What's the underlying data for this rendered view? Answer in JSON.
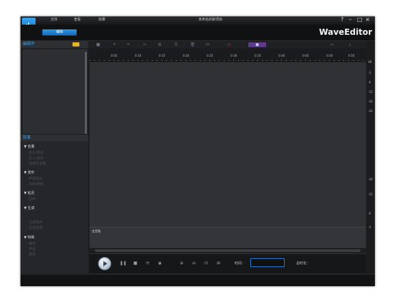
{
  "app": {
    "brand": "WaveEditor",
    "window_title": "未命名的新项目"
  },
  "menu": [
    {
      "label": "文件"
    },
    {
      "label": "查看"
    },
    {
      "label": "效果"
    }
  ],
  "window_controls": {
    "help": "?",
    "min": "–",
    "max": "□",
    "close": "×"
  },
  "ribbon": {
    "edit_tab": "编辑"
  },
  "left_panel": {
    "files_header": "编辑件",
    "effects_header": "效果",
    "categories": [
      {
        "label": "▼ 音量",
        "items": [
          "放大/衰减",
          "淡入/淡出",
          "标准化音量"
        ]
      },
      {
        "label": "▼ 变形",
        "items": [
          "声道混合",
          "反向/倒转"
        ]
      },
      {
        "label": "▼ 延迟",
        "items": [
          "回声"
        ]
      },
      {
        "label": "▼ 生成",
        "items": [
          "生成噪声",
          "生成音调"
        ]
      },
      {
        "label": "▼ 特殊",
        "items": [
          "静音",
          "声道",
          "重复"
        ]
      }
    ]
  },
  "timeline": {
    "ticks": [
      "0:05",
      "0:10",
      "0:15",
      "0:20",
      "0:25",
      "0:30",
      "0:35",
      "0:40",
      "0:45",
      "0:50",
      "0:55"
    ]
  },
  "meter": {
    "labels": [
      "dB",
      "-3",
      "-6",
      "-12",
      "-18",
      "-24",
      "-18",
      "-12",
      "-6",
      "-3"
    ]
  },
  "master": {
    "label": "主音轨"
  },
  "transport": {
    "time_label": "时间：",
    "total_label": "总时长："
  },
  "colors": {
    "accent": "#1e88e5",
    "brand": "#f0f2f4",
    "bg": "#1c1e21"
  }
}
